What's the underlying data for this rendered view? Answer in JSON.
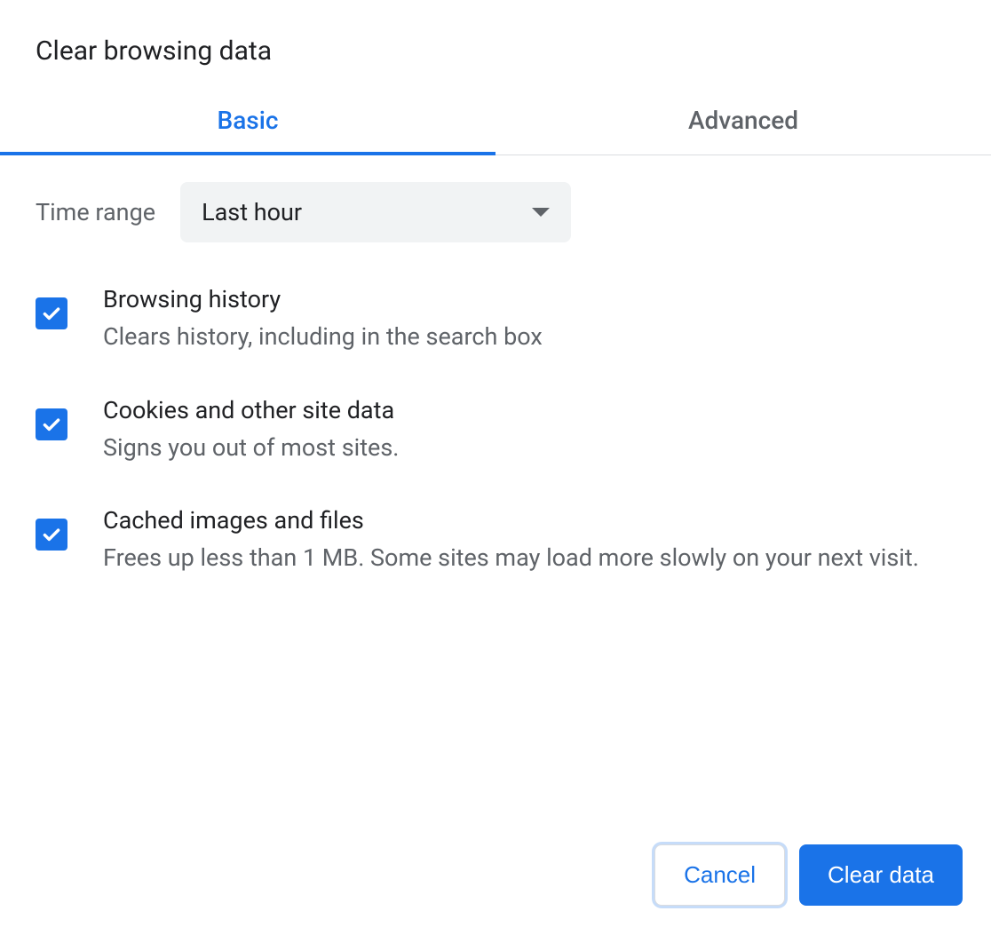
{
  "dialog": {
    "title": "Clear browsing data"
  },
  "tabs": {
    "basic": "Basic",
    "advanced": "Advanced"
  },
  "timeRange": {
    "label": "Time range",
    "value": "Last hour"
  },
  "options": [
    {
      "title": "Browsing history",
      "description": "Clears history, including in the search box",
      "checked": true
    },
    {
      "title": "Cookies and other site data",
      "description": "Signs you out of most sites.",
      "checked": true
    },
    {
      "title": "Cached images and files",
      "description": "Frees up less than 1 MB. Some sites may load more slowly on your next visit.",
      "checked": true
    }
  ],
  "buttons": {
    "cancel": "Cancel",
    "clear": "Clear data"
  }
}
